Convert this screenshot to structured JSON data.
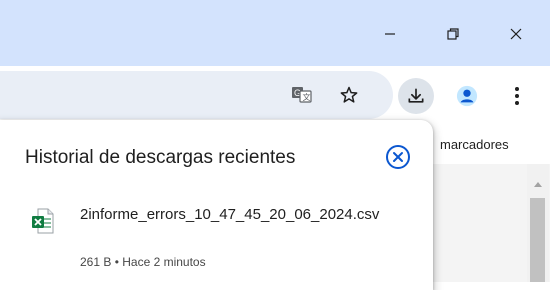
{
  "window_controls": {
    "minimize_icon": "minimize-icon",
    "restore_icon": "restore-icon",
    "close_icon": "close-icon"
  },
  "toolbar": {
    "translate_icon": "translate-icon",
    "bookmark_icon": "star-icon",
    "downloads_icon": "download-icon",
    "profile_icon": "profile-icon",
    "menu_icon": "kebab-menu-icon"
  },
  "bookmarks_bar": {
    "label": "marcadores"
  },
  "downloads_bubble": {
    "title": "Historial de descargas recientes",
    "close_icon": "close-circle-icon",
    "items": [
      {
        "filename": "2informe_errors_10_47_45_20_06_2024.csv",
        "meta": "261 B • Hace 2 minutos",
        "icon": "excel-file-icon"
      }
    ]
  },
  "colors": {
    "titlebar": "#d3e3fd",
    "omnibox": "#e9eef6",
    "accent": "#0b57d0",
    "excel_green": "#107c41"
  }
}
